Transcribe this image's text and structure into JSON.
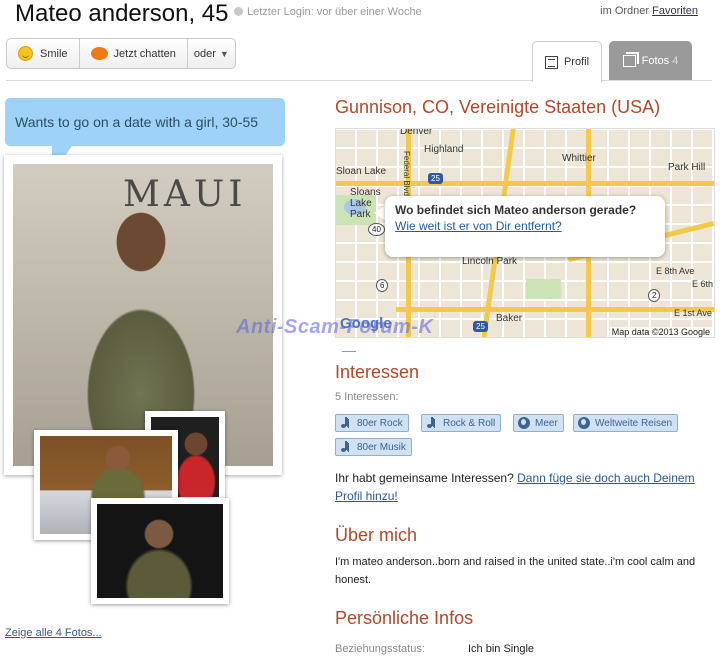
{
  "header": {
    "name_age": "Mateo anderson, 45",
    "last_login": "Letzter Login: vor über einer Woche",
    "folder_prefix": "im Ordner",
    "folder_link": "Favoriten"
  },
  "actions": {
    "smile": "Smile",
    "chat": "Jetzt chatten",
    "more": "oder"
  },
  "tabs": {
    "profil": "Profil",
    "fotos": "Fotos",
    "fotos_count": "4"
  },
  "bubble_text": "Wants to go on a date with a girl, 30-55",
  "photos": {
    "graffiti": "MAUI",
    "show_all": "Zeige alle 4 Fotos..."
  },
  "location": "Gunnison, CO, Vereinigte Staaten (USA)",
  "map": {
    "labels": [
      "Denver",
      "Highland",
      "Whittier",
      "Park Hill",
      "Sloan Lake",
      "Sloans Lake Park",
      "Lincoln Park",
      "Baker",
      "E 8th Ave",
      "E 1st Ave",
      "E 6th",
      "Federal Blvd"
    ],
    "shields": [
      "25",
      "40",
      "6",
      "2",
      "25"
    ],
    "brand": "Google",
    "copyright": "Map data ©2013 Google",
    "popup_question": "Wo befindet sich Mateo anderson gerade?",
    "popup_link": "Wie weit ist er von Dir entfernt?"
  },
  "watermark": "Anti-Scam-Forum-K",
  "interests": {
    "title": "Interessen",
    "count_label": "5 Interessen:",
    "tags": [
      {
        "label": "80er Rock",
        "icon": "music-note-icon"
      },
      {
        "label": "Rock & Roll",
        "icon": "music-note-icon"
      },
      {
        "label": "Meer",
        "icon": "globe-icon"
      },
      {
        "label": "Weltweite Reisen",
        "icon": "globe-icon"
      },
      {
        "label": "80er Musik",
        "icon": "music-note-icon"
      }
    ],
    "common_question": "Ihr habt gemeinsame Interessen?",
    "common_link": "Dann füge sie doch auch Deinem Profil hinzu!"
  },
  "about": {
    "title": "Über mich",
    "text": "I'm mateo anderson..born and raised in the united state..i'm cool calm and honest."
  },
  "personal": {
    "title": "Persönliche Infos",
    "relationship_label": "Beziehungsstatus:",
    "relationship_value": "Ich bin Single"
  },
  "colors": {
    "section_title": "#b4472a",
    "link": "#245b99",
    "bubble": "#9ed2f7",
    "tag_bg": "#cfe1f2",
    "tab_inactive": "#9a9a9a"
  }
}
